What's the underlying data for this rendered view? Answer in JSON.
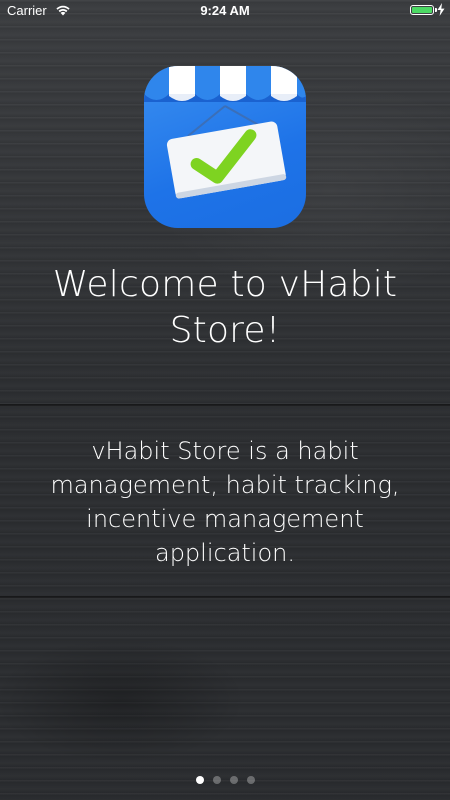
{
  "status_bar": {
    "carrier": "Carrier",
    "time": "9:24 AM",
    "battery_level": 1.0,
    "battery_color": "#4cd964",
    "wifi_icon": "wifi-icon",
    "charging_icon": "charging-bolt-icon"
  },
  "onboarding": {
    "app_icon": "vhabit-store-icon",
    "title_line1": "Welcome to vHabit",
    "title_line2": "Store!",
    "description_lines": [
      "vHabit Store is a habit",
      "management, habit tracking,",
      "incentive management",
      "application."
    ],
    "page_count": 4,
    "current_page": 1
  },
  "colors": {
    "icon_blue": "#1e73e8",
    "check_green": "#7ed321",
    "text": "#ffffff"
  }
}
